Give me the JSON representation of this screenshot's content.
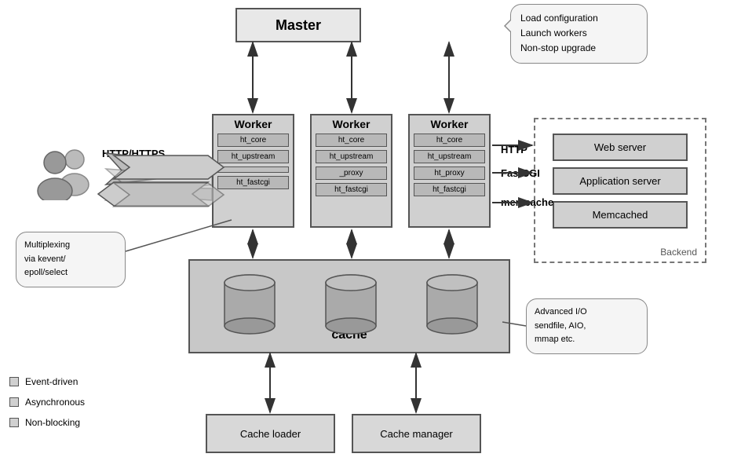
{
  "master": {
    "label": "Master"
  },
  "callout_top": {
    "lines": [
      "Load configuration",
      "Launch workers",
      "Non-stop upgrade"
    ]
  },
  "workers": [
    {
      "title": "Worker",
      "modules": [
        "ht_core",
        "ht_upstream",
        "",
        "ht_fastcgi"
      ]
    },
    {
      "title": "Worker",
      "modules": [
        "ht_core",
        "ht_upstream",
        "_proxy",
        "ht_fastcgi"
      ]
    },
    {
      "title": "Worker",
      "modules": [
        "ht_core",
        "ht_upstream",
        "ht_proxy",
        "ht_fastcgi"
      ]
    }
  ],
  "backend": {
    "label": "Backend",
    "items": [
      "Web server",
      "Application server",
      "Memcached"
    ]
  },
  "proxy_cache": {
    "label": "proxy\ncache"
  },
  "cache_loader": {
    "label": "Cache loader"
  },
  "cache_manager": {
    "label": "Cache manager"
  },
  "labels": {
    "http_https": "HTTP/HTTPS",
    "http": "HTTP",
    "fastcgi": "FastCGI",
    "memcache": "memcache"
  },
  "callout_left": {
    "text": "Multiplexing\nvia kevent/\nepoll/select"
  },
  "callout_right": {
    "text": "Advanced I/O\nsendfile, AIO,\nmmap etc."
  },
  "legend": {
    "items": [
      "Event-driven",
      "Asynchronous",
      "Non-blocking"
    ]
  }
}
